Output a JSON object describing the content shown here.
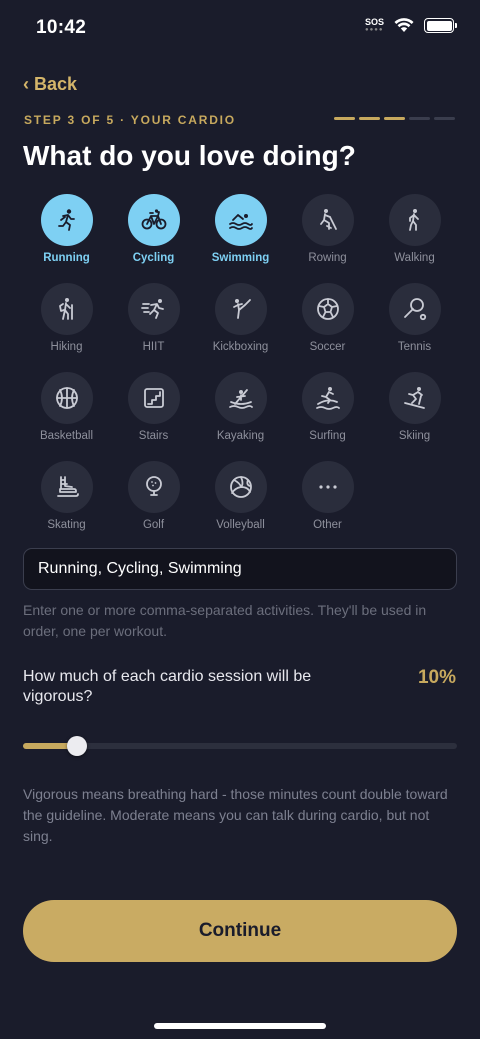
{
  "status_bar": {
    "time": "10:42",
    "sos": "SOS"
  },
  "nav": {
    "back_label": "‹ Back"
  },
  "step": {
    "label": "STEP 3 OF 5 · YOUR CARDIO",
    "current": 3,
    "total": 5
  },
  "title": "What do you love doing?",
  "activities": [
    {
      "label": "Running",
      "icon": "running-icon",
      "selected": true
    },
    {
      "label": "Cycling",
      "icon": "cycling-icon",
      "selected": true
    },
    {
      "label": "Swimming",
      "icon": "swimming-icon",
      "selected": true
    },
    {
      "label": "Rowing",
      "icon": "rowing-icon",
      "selected": false
    },
    {
      "label": "Walking",
      "icon": "walking-icon",
      "selected": false
    },
    {
      "label": "Hiking",
      "icon": "hiking-icon",
      "selected": false
    },
    {
      "label": "HIIT",
      "icon": "hiit-icon",
      "selected": false
    },
    {
      "label": "Kickboxing",
      "icon": "kickboxing-icon",
      "selected": false
    },
    {
      "label": "Soccer",
      "icon": "soccer-ball-icon",
      "selected": false
    },
    {
      "label": "Tennis",
      "icon": "tennis-racket-icon",
      "selected": false
    },
    {
      "label": "Basketball",
      "icon": "basketball-icon",
      "selected": false
    },
    {
      "label": "Stairs",
      "icon": "stairs-icon",
      "selected": false
    },
    {
      "label": "Kayaking",
      "icon": "kayaking-icon",
      "selected": false
    },
    {
      "label": "Surfing",
      "icon": "surfing-icon",
      "selected": false
    },
    {
      "label": "Skiing",
      "icon": "skiing-icon",
      "selected": false
    },
    {
      "label": "Skating",
      "icon": "ice-skate-icon",
      "selected": false
    },
    {
      "label": "Golf",
      "icon": "golf-ball-icon",
      "selected": false
    },
    {
      "label": "Volleyball",
      "icon": "volleyball-icon",
      "selected": false
    },
    {
      "label": "Other",
      "icon": "more-dots-icon",
      "selected": false
    }
  ],
  "activities_input": {
    "value": "Running, Cycling, Swimming"
  },
  "hint": "Enter one or more comma-separated activities. They'll be used in order, one per workout.",
  "vigorous": {
    "question": "How much of each cardio session will be vigorous?",
    "percent_label": "10%",
    "value": 0.1
  },
  "note": "Vigorous means breathing hard - those minutes count double toward the guideline. Moderate means you can talk during cardio, but not sing.",
  "continue_label": "Continue",
  "colors": {
    "background": "#1a1c2b",
    "accent": "#c7a95e",
    "selected": "#7ed0f3",
    "circle": "#2a2d3c"
  }
}
